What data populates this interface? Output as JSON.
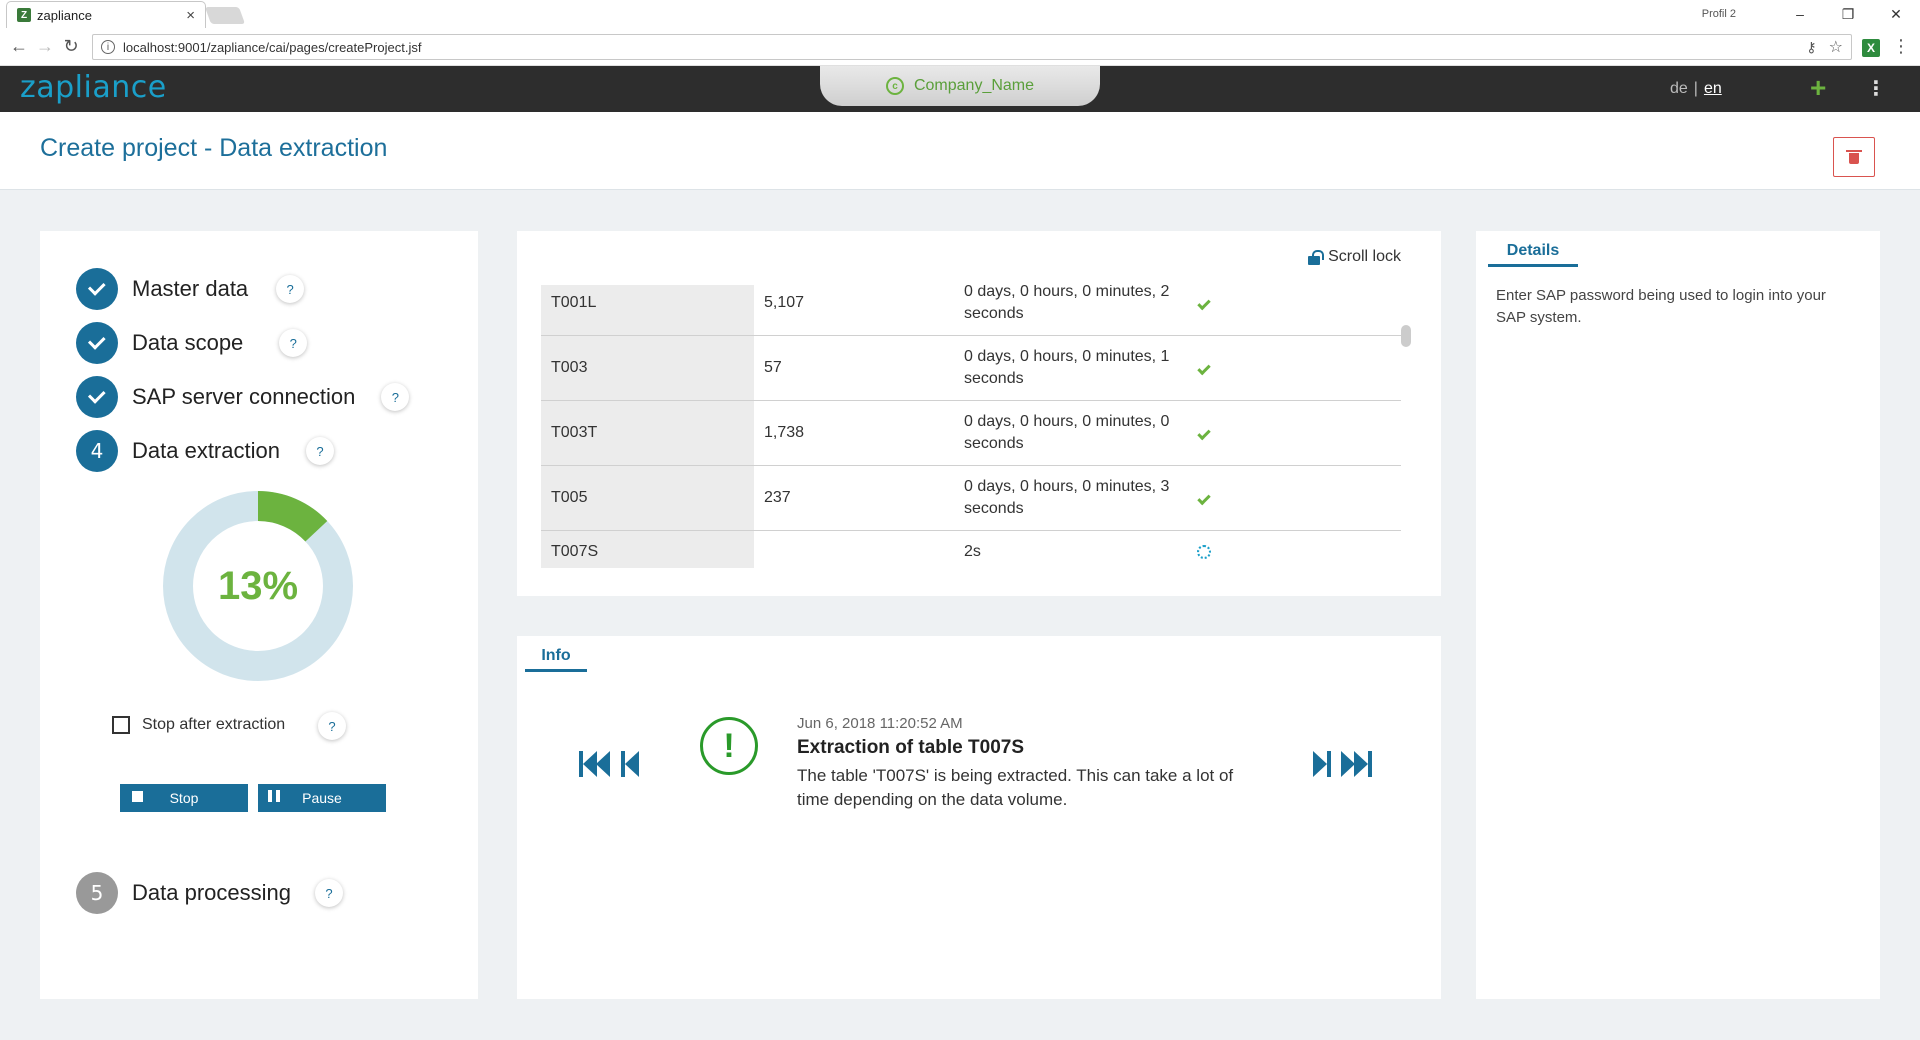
{
  "browser": {
    "tab_title": "zapliance",
    "tab_close": "×",
    "profile": "Profil 2",
    "url": "localhost:9001/zapliance/cai/pages/createProject.jsf",
    "win_minimize": "–",
    "win_restore": "❐",
    "win_close": "✕"
  },
  "header": {
    "logo": "zapliance",
    "company": "Company_Name",
    "lang_de": "de",
    "lang_sep": "|",
    "lang_en": "en"
  },
  "page": {
    "title": "Create project - Data extraction"
  },
  "steps": [
    {
      "number": "",
      "label": "Master data",
      "status": "done"
    },
    {
      "number": "",
      "label": "Data scope",
      "status": "done"
    },
    {
      "number": "",
      "label": "SAP server connection",
      "status": "done"
    },
    {
      "number": "4",
      "label": "Data extraction",
      "status": "active"
    },
    {
      "number": "5",
      "label": "Data processing",
      "status": "pending"
    }
  ],
  "help_label": "?",
  "progress": {
    "percent": 13,
    "percent_label": "13%",
    "colors": {
      "fill": "#6cb33f",
      "track": "#d1e4ec"
    }
  },
  "extraction": {
    "stop_after_label": "Stop after extraction",
    "stop_after_checked": false,
    "stop_button": "Stop",
    "pause_button": "Pause"
  },
  "table": {
    "scroll_lock_label": "Scroll lock",
    "rows": [
      {
        "name": "T001L",
        "count": "5,107",
        "time": "0 days, 0 hours, 0 minutes, 2 seconds",
        "status": "done"
      },
      {
        "name": "T003",
        "count": "57",
        "time": "0 days, 0 hours, 0 minutes, 1 seconds",
        "status": "done"
      },
      {
        "name": "T003T",
        "count": "1,738",
        "time": "0 days, 0 hours, 0 minutes, 0 seconds",
        "status": "done"
      },
      {
        "name": "T005",
        "count": "237",
        "time": "0 days, 0 hours, 0 minutes, 3 seconds",
        "status": "done"
      },
      {
        "name": "T007S",
        "count": "",
        "time": "2s",
        "status": "running"
      }
    ]
  },
  "info": {
    "tab_label": "Info",
    "timestamp": "Jun 6, 2018 11:20:52 AM",
    "title": "Extraction of table T007S",
    "body": "The table 'T007S' is being extracted. This can take a lot of time depending on the data volume.",
    "icon": "exclamation-icon"
  },
  "details": {
    "tab_label": "Details",
    "text": "Enter SAP password being used to login into your SAP system."
  },
  "colors": {
    "primary": "#1a6e99",
    "success": "#6cb33f",
    "danger": "#d9534f",
    "header_bg": "#2d2d2d"
  }
}
